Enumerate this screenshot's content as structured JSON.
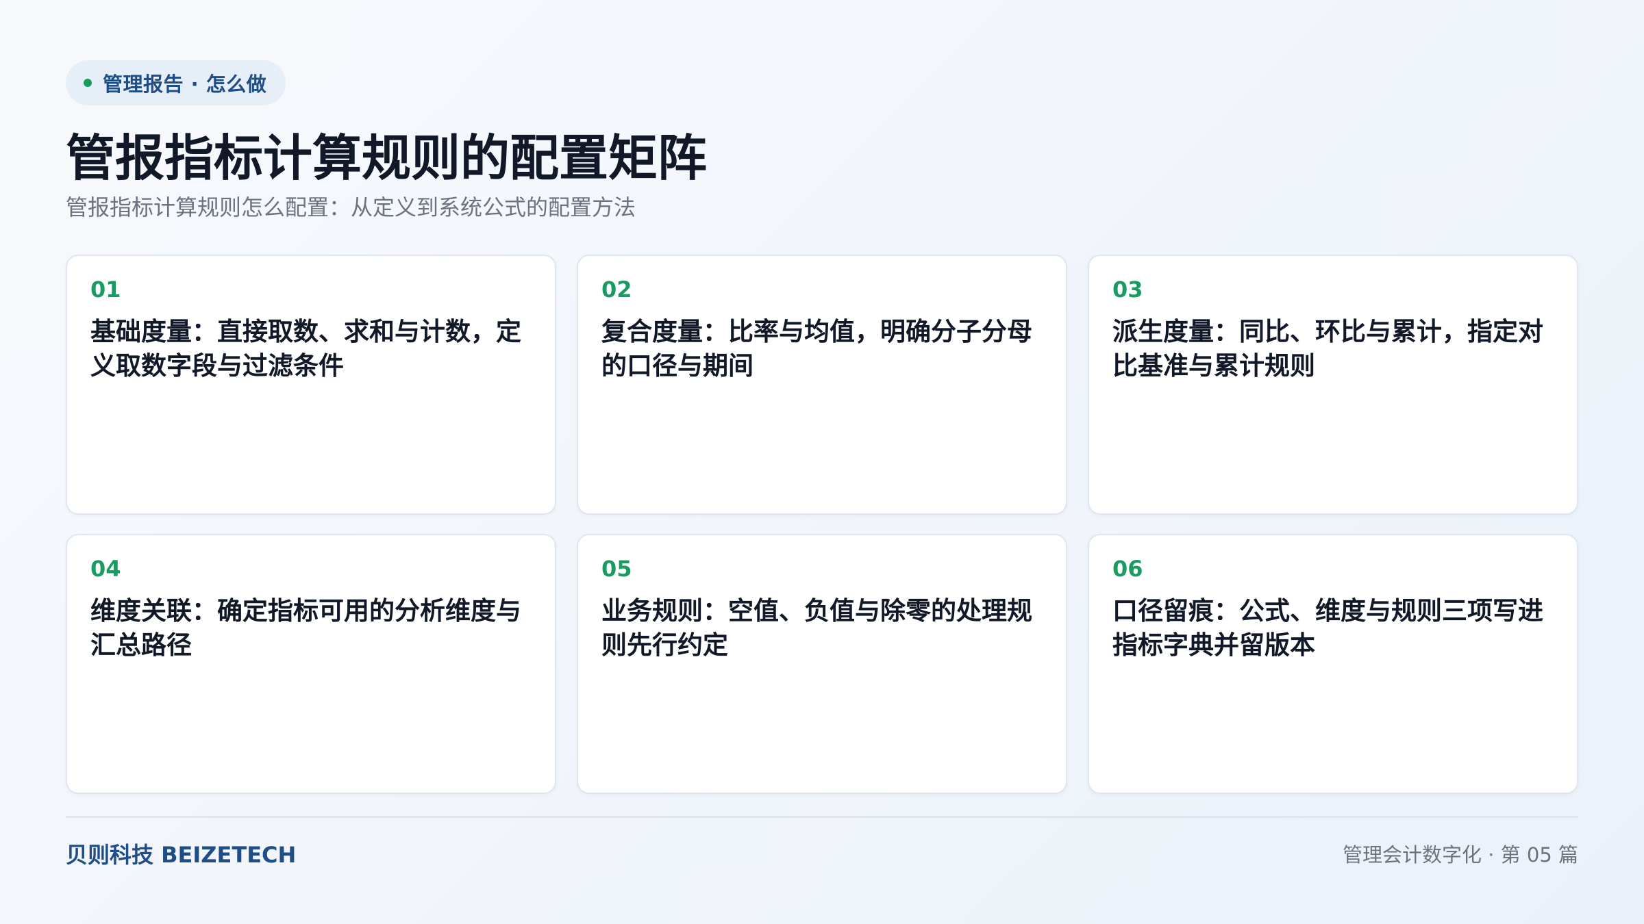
{
  "header": {
    "pill_label": "管理报告 · 怎么做",
    "title": "管报指标计算规则的配置矩阵",
    "subtitle": "管报指标计算规则怎么配置：从定义到系统公式的配置方法"
  },
  "cards": [
    {
      "num": "01",
      "text": "基础度量：直接取数、求和与计数，定义取数字段与过滤条件"
    },
    {
      "num": "02",
      "text": "复合度量：比率与均值，明确分子分母的口径与期间"
    },
    {
      "num": "03",
      "text": "派生度量：同比、环比与累计，指定对比基准与累计规则"
    },
    {
      "num": "04",
      "text": "维度关联：确定指标可用的分析维度与汇总路径"
    },
    {
      "num": "05",
      "text": "业务规则：空值、负值与除零的处理规则先行约定"
    },
    {
      "num": "06",
      "text": "口径留痕：公式、维度与规则三项写进指标字典并留版本"
    }
  ],
  "footer": {
    "brand": "贝则科技 BEIZETECH",
    "series": "管理会计数字化 · 第 05 篇"
  },
  "colors": {
    "accent_green": "#1a9b62",
    "brand_blue": "#1f4e86",
    "pill_bg": "#e6eef8"
  }
}
